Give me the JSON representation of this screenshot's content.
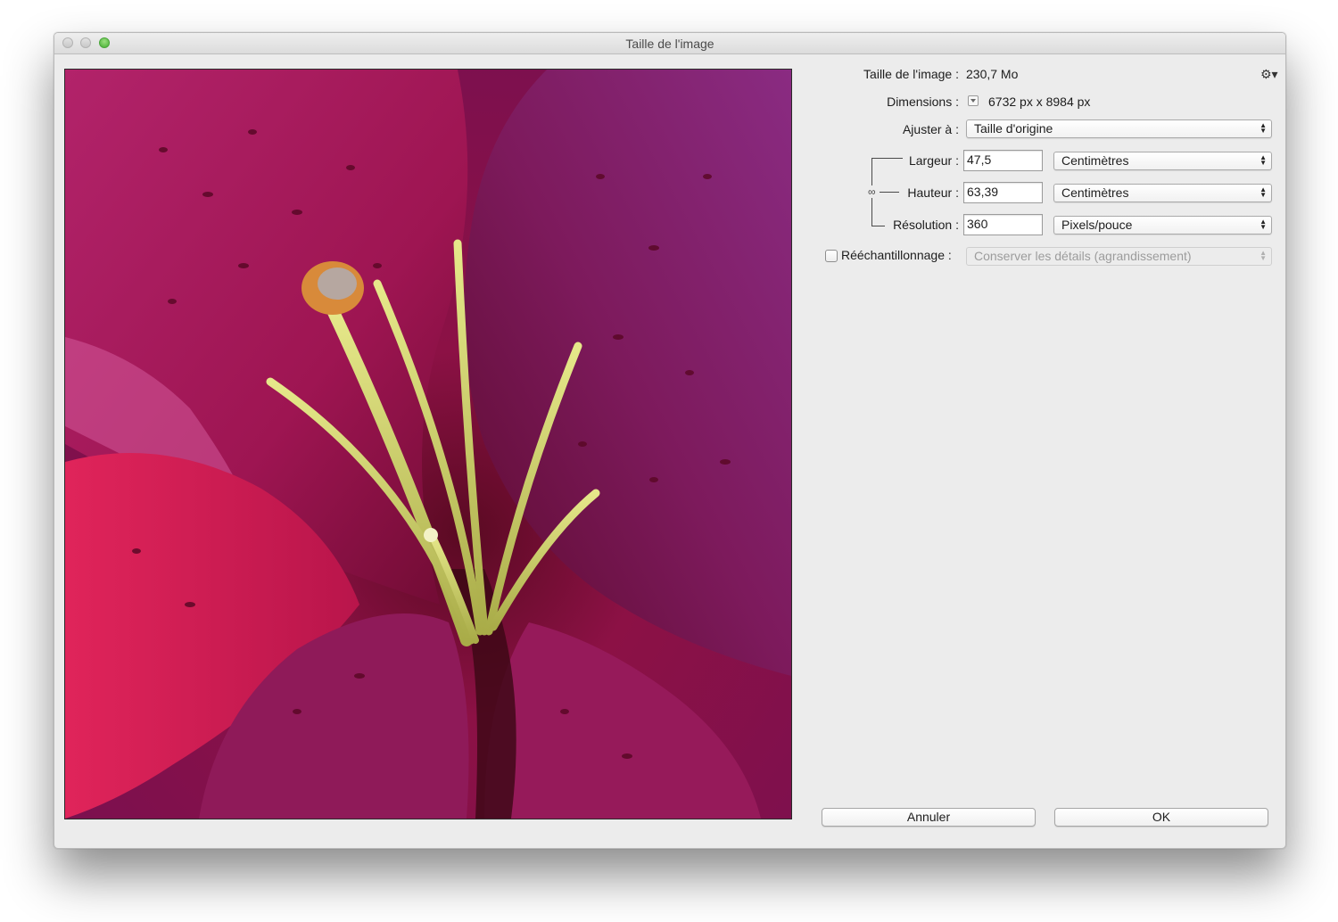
{
  "window": {
    "title": "Taille de l'image"
  },
  "form": {
    "image_size_label": "Taille de l'image :",
    "image_size_value": "230,7 Mo",
    "dimensions_label": "Dimensions :",
    "dimensions_value": "6732 px x 8984 px",
    "fit_to_label": "Ajuster à :",
    "fit_to_value": "Taille d'origine",
    "width_label": "Largeur :",
    "width_value": "47,5",
    "width_unit": "Centimètres",
    "height_label": "Hauteur :",
    "height_value": "63,39",
    "height_unit": "Centimètres",
    "resolution_label": "Résolution :",
    "resolution_value": "360",
    "resolution_unit": "Pixels/pouce",
    "resample_label": "Rééchantillonnage :",
    "resample_checked": false,
    "resample_method": "Conserver les détails (agrandissement)"
  },
  "buttons": {
    "cancel": "Annuler",
    "ok": "OK"
  },
  "icons": {
    "settings": "gear-icon",
    "dimensions_toggle": "disclosure-triangle-icon",
    "constrain": "chain-link-icon",
    "popup": "up-down-arrows-icon"
  },
  "colors": {
    "window_bg": "#ececec",
    "petal_magenta": "#a3124d",
    "stamen_yellow": "#d6dc6c",
    "anther_orange": "#d88a3a"
  }
}
